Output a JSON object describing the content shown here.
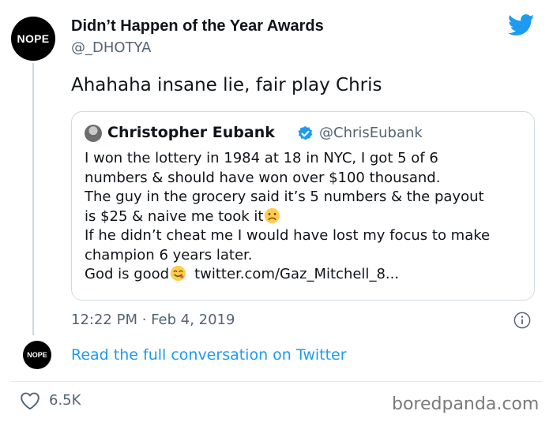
{
  "author": {
    "avatar_text": "NOPE",
    "name": "Didn’t Happen of the Year Awards",
    "handle": "@_DHOTYA"
  },
  "tweet": {
    "text": "Ahahaha insane lie, fair play Chris"
  },
  "quoted": {
    "name": "Christopher Eubank",
    "handle": "@ChrisEubank",
    "lines": [
      "I won the lottery in 1984 at 18 in NYC, I got 5 of 6",
      "numbers & should have won over $100 thousand.",
      "The guy in the grocery said it’s 5 numbers & the payout",
      "is $25 & naive me took it",
      "If he didn’t cheat me I would have lost my focus to make",
      "champion 6 years later.",
      "God is good",
      "twitter.com/Gaz_Mitchell_8..."
    ]
  },
  "timestamp": "12:22 PM · Feb 4, 2019",
  "conversation": {
    "avatar_text": "NOPE",
    "link_label": "Read the full conversation on Twitter"
  },
  "likes": "6.5K",
  "watermark": "boredpanda.com",
  "colors": {
    "twitter_blue": "#1d9bf0",
    "secondary_text": "#536471",
    "border": "#cfd9de"
  },
  "icons": [
    "twitter-bird-icon",
    "verified-badge-icon",
    "frowning-face-emoji",
    "smiling-face-emoji",
    "info-icon",
    "heart-icon"
  ]
}
